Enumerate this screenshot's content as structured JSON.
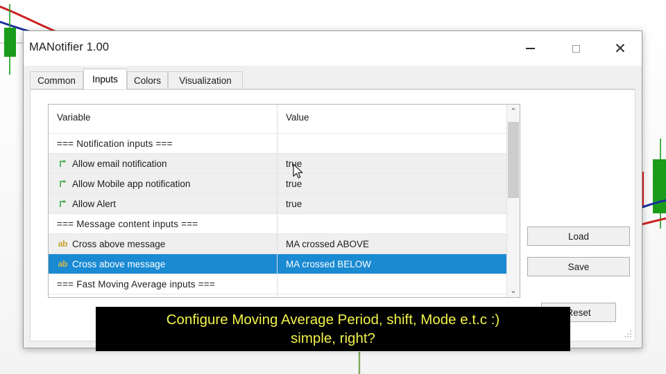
{
  "window": {
    "title": "MANotifier 1.00",
    "controls": {
      "minimize": "–",
      "maximize": "□",
      "close": "✕"
    }
  },
  "tabs": [
    {
      "label": "Common",
      "active": false
    },
    {
      "label": "Inputs",
      "active": true
    },
    {
      "label": "Colors",
      "active": false
    },
    {
      "label": "Visualization",
      "active": false
    }
  ],
  "table": {
    "headers": {
      "variable": "Variable",
      "value": "Value"
    },
    "rows": [
      {
        "icon": "",
        "variable": "=== Notification inputs ===",
        "value": "",
        "type": "section",
        "selected": false
      },
      {
        "icon": "boolean-arrow-icon",
        "variable": "Allow email notification",
        "value": "true",
        "type": "bool",
        "selected": false
      },
      {
        "icon": "boolean-arrow-icon",
        "variable": "Allow Mobile app notification",
        "value": "true",
        "type": "bool",
        "selected": false
      },
      {
        "icon": "boolean-arrow-icon",
        "variable": "Allow Alert",
        "value": "true",
        "type": "bool",
        "selected": false
      },
      {
        "icon": "",
        "variable": "=== Message content inputs ===",
        "value": "",
        "type": "section",
        "selected": false
      },
      {
        "icon": "ab",
        "variable": "Cross above message",
        "value": "MA crossed ABOVE",
        "type": "string",
        "selected": false
      },
      {
        "icon": "ab",
        "variable": "Cross above message",
        "value": "MA crossed BELOW",
        "type": "string",
        "selected": true
      },
      {
        "icon": "",
        "variable": "=== Fast Moving Average inputs ===",
        "value": "",
        "type": "section",
        "selected": false
      }
    ]
  },
  "scrollbar": {
    "up_arrow": "⌃",
    "down_arrow": "⌄"
  },
  "buttons": {
    "load": "Load",
    "save": "Save",
    "reset": "Reset"
  },
  "caption": {
    "line1": "Configure Moving Average Period, shift, Mode e.t.c :)",
    "line2": "simple, right?"
  },
  "colors": {
    "selection_blue": "#1a8ad3",
    "caption_text": "#f2f24b",
    "caption_bg": "#000000",
    "bull_candle": "#1a9c1a",
    "bear_candle": "#e01b1b",
    "fast_ma_line": "#1a2f9c",
    "slow_ma_line": "#cc2222",
    "type_icon_bool": "#4caf50",
    "type_icon_string": "#c9a227"
  }
}
